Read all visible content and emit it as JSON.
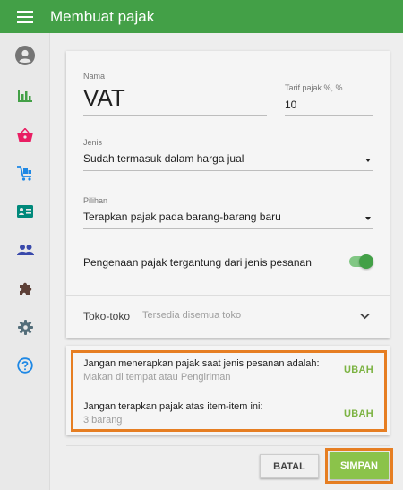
{
  "app": {
    "title": "Membuat pajak"
  },
  "sidebar": {
    "items": [
      {
        "icon": "account-icon",
        "color": "#757575"
      },
      {
        "icon": "reports-icon",
        "color": "#43a047"
      },
      {
        "icon": "sales-icon",
        "color": "#e91e63"
      },
      {
        "icon": "items-icon",
        "color": "#1e88e5"
      },
      {
        "icon": "employees-icon",
        "color": "#00897b"
      },
      {
        "icon": "customers-icon",
        "color": "#3949ab"
      },
      {
        "icon": "integrations-icon",
        "color": "#5d4037"
      },
      {
        "icon": "settings-icon",
        "color": "#546e7a"
      },
      {
        "icon": "help-icon",
        "color": "#1e88e5"
      }
    ]
  },
  "form": {
    "name_label": "Nama",
    "name_value": "VAT",
    "rate_label": "Tarif pajak %, %",
    "rate_value": "10",
    "type_label": "Jenis",
    "type_value": "Sudah termasuk dalam harga jual",
    "option_label": "Pilihan",
    "option_value": "Terapkan pajak pada barang-barang baru",
    "toggle_label": "Pengenaan pajak tergantung dari jenis pesanan",
    "toggle_on": true,
    "stores_label": "Toko-toko",
    "stores_value": "Tersedia disemua toko"
  },
  "exceptions": {
    "order_type_title": "Jangan menerapkan pajak saat jenis pesanan adalah:",
    "order_type_value": "Makan di tempat atau Pengiriman",
    "order_type_action": "UBAH",
    "items_title": "Jangan terapkan pajak atas item-item ini:",
    "items_value": "3 barang",
    "items_action": "UBAH"
  },
  "actions": {
    "cancel": "BATAL",
    "save": "SIMPAN"
  },
  "colors": {
    "primary": "#43a047",
    "accent": "#8bc34a",
    "highlight": "#e67e22"
  }
}
